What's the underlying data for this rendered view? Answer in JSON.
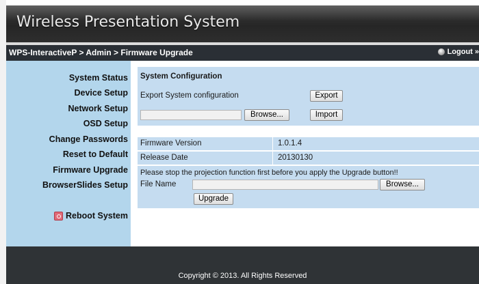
{
  "header": {
    "title": "Wireless Presentation System"
  },
  "nav": {
    "breadcrumb": "WPS-InteractiveP > Admin > Firmware Upgrade",
    "logout": "Logout »"
  },
  "sidebar": {
    "items": [
      {
        "label": "System Status"
      },
      {
        "label": "Device Setup"
      },
      {
        "label": "Network Setup"
      },
      {
        "label": "OSD Setup"
      },
      {
        "label": "Change Passwords"
      },
      {
        "label": "Reset to Default"
      },
      {
        "label": "Firmware Upgrade"
      },
      {
        "label": "BrowserSlides Setup"
      }
    ],
    "reboot": "Reboot System"
  },
  "config": {
    "title": "System Configuration",
    "export_label": "Export System configuration",
    "export_button": "Export",
    "browse_button": "Browse...",
    "import_button": "Import"
  },
  "firmware": {
    "version_label": "Firmware Version",
    "version_value": "1.0.1.4",
    "date_label": "Release Date",
    "date_value": "20130130",
    "warning": "Please stop the projection function first before you apply the Upgrade button!!",
    "file_label": "File Name",
    "browse_button": "Browse...",
    "upgrade_button": "Upgrade"
  },
  "footer": {
    "copyright": "Copyright © 2013. All Rights Reserved"
  }
}
